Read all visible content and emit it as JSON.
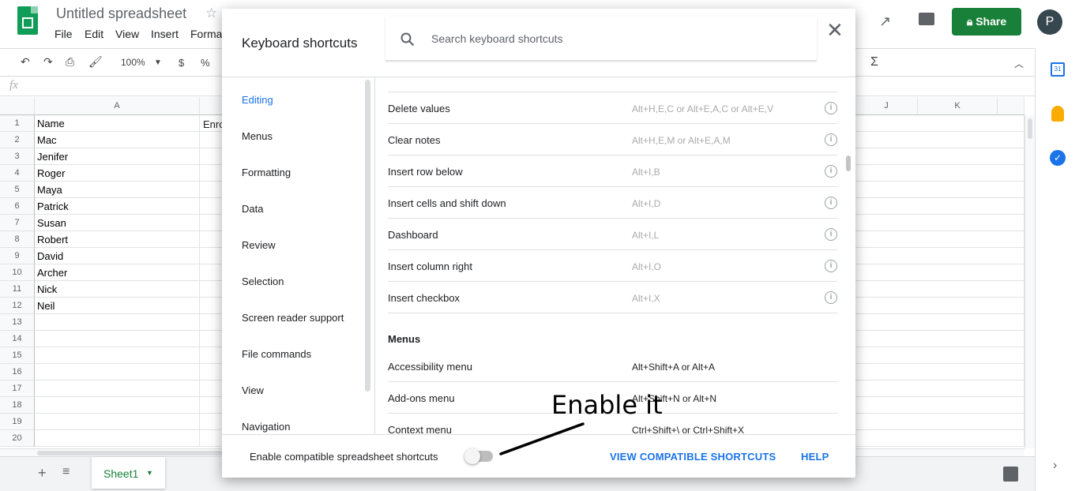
{
  "app": {
    "title": "Untitled spreadsheet",
    "menus": [
      "File",
      "Edit",
      "View",
      "Insert",
      "Forma"
    ],
    "share_label": "Share",
    "avatar_letter": "P",
    "zoom": "100%",
    "currency": "$",
    "percent": "%",
    "fx": "fx",
    "sheet_tab": "Sheet1"
  },
  "grid": {
    "columns": [
      "A",
      "Enro",
      "J",
      "K"
    ],
    "rows": [
      "1",
      "2",
      "3",
      "4",
      "5",
      "6",
      "7",
      "8",
      "9",
      "10",
      "11",
      "12",
      "13",
      "14",
      "15",
      "16",
      "17",
      "18",
      "19",
      "20"
    ],
    "col_a": [
      "Name",
      "Mac",
      "Jenifer",
      "Roger",
      "Maya",
      "Patrick",
      "Susan",
      "Robert",
      "David",
      "Archer",
      "Nick",
      "Neil"
    ]
  },
  "dialog": {
    "title": "Keyboard shortcuts",
    "search_placeholder": "Search keyboard shortcuts",
    "nav": [
      "Editing",
      "Menus",
      "Formatting",
      "Data",
      "Review",
      "Selection",
      "Screen reader support",
      "File commands",
      "View",
      "Navigation"
    ],
    "editing_rows": [
      {
        "name": "Delete values",
        "keys": "Alt+H,E,C or Alt+E,A,C or Alt+E,V"
      },
      {
        "name": "Clear notes",
        "keys": "Alt+H,E,M or Alt+E,A,M"
      },
      {
        "name": "Insert row below",
        "keys": "Alt+I,B"
      },
      {
        "name": "Insert cells and shift down",
        "keys": "Alt+I,D"
      },
      {
        "name": "Dashboard",
        "keys": "Alt+I,L"
      },
      {
        "name": "Insert column right",
        "keys": "Alt+I,O"
      },
      {
        "name": "Insert checkbox",
        "keys": "Alt+I,X"
      }
    ],
    "menus_heading": "Menus",
    "menu_rows": [
      {
        "name": "Accessibility menu",
        "keys": "Alt+Shift+A or Alt+A"
      },
      {
        "name": "Add-ons menu",
        "keys": "Alt+Shift+N or Alt+N"
      },
      {
        "name": "Context menu",
        "keys": "Ctrl+Shift+\\ or Ctrl+Shift+X"
      }
    ],
    "footer_text": "Enable compatible spreadsheet shortcuts",
    "toggle_on": false,
    "view_link": "VIEW COMPATIBLE SHORTCUTS",
    "help_link": "HELP"
  },
  "annotation": "Enable it",
  "colors": {
    "accent": "#1a73e8",
    "share": "#188038",
    "sheets_green": "#0f9d58"
  }
}
